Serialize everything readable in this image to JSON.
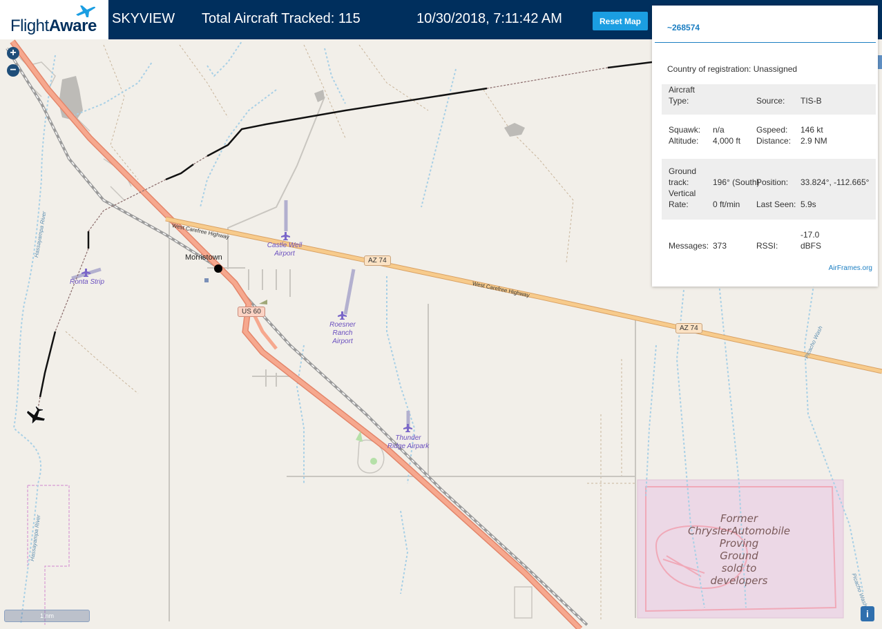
{
  "header": {
    "logo_text_main": "Flight",
    "logo_text_bold": "Aware",
    "app_name": "SKYVIEW",
    "aircraft_tracked": "Total Aircraft Tracked: 115",
    "datetime": "10/30/2018, 7:11:42 AM",
    "reset_button": "Reset Map"
  },
  "map": {
    "zoom_in": "+",
    "zoom_out": "−",
    "scale_label": "1 nm",
    "info_button": "i",
    "town": "Morristown",
    "airports": [
      {
        "name_lines": [
          "Castle Well",
          "Airport"
        ]
      },
      {
        "name_lines": [
          "Ronta Strip"
        ]
      },
      {
        "name_lines": [
          "Roesner",
          "Ranch",
          "Airport"
        ]
      },
      {
        "name_lines": [
          "Thunder",
          "Ridge Airpark"
        ]
      }
    ],
    "roads": {
      "highway_name": "West Carefree Highway",
      "az74": "AZ 74",
      "us60": "US 60"
    },
    "rivers": {
      "hassayampa": "Hassayampa River",
      "picacho": "Picacho Wash"
    },
    "area_label": "Former ChryslerAutomobile Proving Ground sold to developers",
    "area_lines": [
      "Former",
      "ChryslerAutomobile",
      "Proving",
      "Ground",
      "sold to",
      "developers"
    ]
  },
  "panel": {
    "aircraft_id": "~268574",
    "country": "Country of registration: Unassigned",
    "aircraft_type_label": "Aircraft Type:",
    "aircraft_type_label_1": "Aircraft",
    "aircraft_type_label_2": "Type:",
    "source_label": "Source:",
    "source_value": "TIS-B",
    "squawk_label": "Squawk:",
    "squawk_value": "n/a",
    "gspeed_label": "Gspeed:",
    "gspeed_value": "146 kt",
    "altitude_label": "Altitude:",
    "altitude_value": "4,000 ft",
    "distance_label": "Distance:",
    "distance_value": "2.9 NM",
    "ground_track_label_1": "Ground",
    "ground_track_label_2": "track:",
    "ground_track_value": "196° (South)",
    "position_label": "Position:",
    "position_value": "33.824°, -112.665°",
    "vertical_rate_label_1": "Vertical",
    "vertical_rate_label_2": "Rate:",
    "vertical_rate_value": "0 ft/min",
    "last_seen_label": "Last Seen:",
    "last_seen_value": "5.9s",
    "messages_label": "Messages:",
    "messages_value": "373",
    "rssi_label": "RSSI:",
    "rssi_value_1": "-17.0",
    "rssi_value_2": "dBFS",
    "airframes_link": "AirFrames.org"
  },
  "colors": {
    "header_bg": "#002f5d",
    "accent_blue": "#1b9ee2",
    "us60_road": "#f4a58a",
    "az74_road": "#f5c98a",
    "river": "#a8d0e6",
    "area_fill": "#ecd8e6"
  }
}
